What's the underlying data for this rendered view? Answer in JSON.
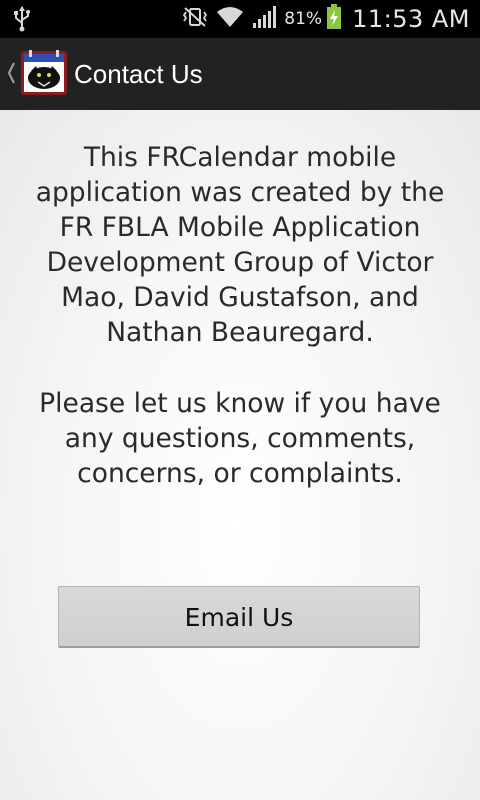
{
  "status_bar": {
    "battery_percent": "81%",
    "time": "11:53 AM",
    "icons": [
      "usb-icon",
      "mute-vibrate-icon",
      "wifi-icon",
      "signal-icon",
      "battery-charging-icon"
    ]
  },
  "action_bar": {
    "title": "Contact Us",
    "icon": "panther-app-icon"
  },
  "content": {
    "paragraph_1": "This FRCalendar mobile application was created by the FR FBLA Mobile Application Development Group of Victor Mao, David Gustafson, and Nathan Beauregard.",
    "paragraph_2": "Please let us know if you have any questions, comments, concerns, or complaints.",
    "email_button_label": "Email Us"
  },
  "colors": {
    "status_bar_bg": "#000000",
    "action_bar_bg": "#222222",
    "content_bg": "#f3f3f3",
    "button_bg": "#d4d4d4",
    "battery_green": "#8cc63f"
  }
}
